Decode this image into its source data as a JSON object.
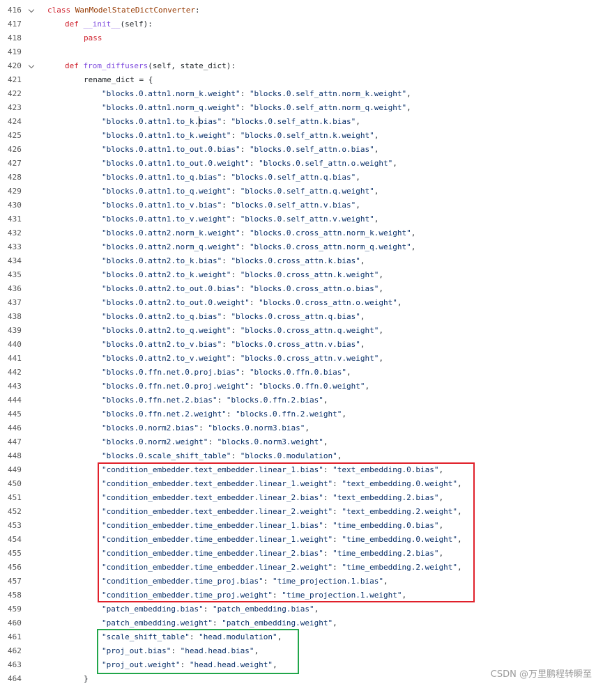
{
  "lines": [
    {
      "n": "416",
      "indent": 0,
      "fold": true,
      "parts": [
        [
          "kw",
          "class "
        ],
        [
          "cls",
          "WanModelStateDictConverter"
        ],
        [
          "plain",
          ":"
        ]
      ]
    },
    {
      "n": "417",
      "indent": 1,
      "fold": false,
      "parts": [
        [
          "kw",
          "def "
        ],
        [
          "fn",
          "__init__"
        ],
        [
          "plain",
          "(self):"
        ]
      ]
    },
    {
      "n": "418",
      "indent": 2,
      "fold": false,
      "parts": [
        [
          "kw",
          "pass"
        ]
      ]
    },
    {
      "n": "419",
      "indent": 0,
      "fold": false,
      "parts": []
    },
    {
      "n": "420",
      "indent": 1,
      "fold": true,
      "parts": [
        [
          "kw",
          "def "
        ],
        [
          "fn",
          "from_diffusers"
        ],
        [
          "plain",
          "(self, state_dict):"
        ]
      ]
    },
    {
      "n": "421",
      "indent": 2,
      "fold": false,
      "parts": [
        [
          "plain",
          "rename_dict = {"
        ]
      ]
    },
    {
      "n": "422",
      "indent": 3,
      "fold": false,
      "parts": [
        [
          "str",
          "\"blocks.0.attn1.norm_k.weight\""
        ],
        [
          "plain",
          ": "
        ],
        [
          "str",
          "\"blocks.0.self_attn.norm_k.weight\""
        ],
        [
          "plain",
          ","
        ]
      ]
    },
    {
      "n": "423",
      "indent": 3,
      "fold": false,
      "parts": [
        [
          "str",
          "\"blocks.0.attn1.norm_q.weight\""
        ],
        [
          "plain",
          ": "
        ],
        [
          "str",
          "\"blocks.0.self_attn.norm_q.weight\""
        ],
        [
          "plain",
          ","
        ]
      ]
    },
    {
      "n": "424",
      "indent": 3,
      "fold": false,
      "parts": [
        [
          "str",
          "\"blocks.0.attn1.to_k.bias\""
        ],
        [
          "plain",
          ": "
        ],
        [
          "str",
          "\"blocks.0.self_attn.k.bias\""
        ],
        [
          "plain",
          ","
        ]
      ]
    },
    {
      "n": "425",
      "indent": 3,
      "fold": false,
      "parts": [
        [
          "str",
          "\"blocks.0.attn1.to_k.weight\""
        ],
        [
          "plain",
          ": "
        ],
        [
          "str",
          "\"blocks.0.self_attn.k.weight\""
        ],
        [
          "plain",
          ","
        ]
      ]
    },
    {
      "n": "426",
      "indent": 3,
      "fold": false,
      "parts": [
        [
          "str",
          "\"blocks.0.attn1.to_out.0.bias\""
        ],
        [
          "plain",
          ": "
        ],
        [
          "str",
          "\"blocks.0.self_attn.o.bias\""
        ],
        [
          "plain",
          ","
        ]
      ]
    },
    {
      "n": "427",
      "indent": 3,
      "fold": false,
      "parts": [
        [
          "str",
          "\"blocks.0.attn1.to_out.0.weight\""
        ],
        [
          "plain",
          ": "
        ],
        [
          "str",
          "\"blocks.0.self_attn.o.weight\""
        ],
        [
          "plain",
          ","
        ]
      ]
    },
    {
      "n": "428",
      "indent": 3,
      "fold": false,
      "parts": [
        [
          "str",
          "\"blocks.0.attn1.to_q.bias\""
        ],
        [
          "plain",
          ": "
        ],
        [
          "str",
          "\"blocks.0.self_attn.q.bias\""
        ],
        [
          "plain",
          ","
        ]
      ]
    },
    {
      "n": "429",
      "indent": 3,
      "fold": false,
      "parts": [
        [
          "str",
          "\"blocks.0.attn1.to_q.weight\""
        ],
        [
          "plain",
          ": "
        ],
        [
          "str",
          "\"blocks.0.self_attn.q.weight\""
        ],
        [
          "plain",
          ","
        ]
      ]
    },
    {
      "n": "430",
      "indent": 3,
      "fold": false,
      "parts": [
        [
          "str",
          "\"blocks.0.attn1.to_v.bias\""
        ],
        [
          "plain",
          ": "
        ],
        [
          "str",
          "\"blocks.0.self_attn.v.bias\""
        ],
        [
          "plain",
          ","
        ]
      ]
    },
    {
      "n": "431",
      "indent": 3,
      "fold": false,
      "parts": [
        [
          "str",
          "\"blocks.0.attn1.to_v.weight\""
        ],
        [
          "plain",
          ": "
        ],
        [
          "str",
          "\"blocks.0.self_attn.v.weight\""
        ],
        [
          "plain",
          ","
        ]
      ]
    },
    {
      "n": "432",
      "indent": 3,
      "fold": false,
      "parts": [
        [
          "str",
          "\"blocks.0.attn2.norm_k.weight\""
        ],
        [
          "plain",
          ": "
        ],
        [
          "str",
          "\"blocks.0.cross_attn.norm_k.weight\""
        ],
        [
          "plain",
          ","
        ]
      ]
    },
    {
      "n": "433",
      "indent": 3,
      "fold": false,
      "parts": [
        [
          "str",
          "\"blocks.0.attn2.norm_q.weight\""
        ],
        [
          "plain",
          ": "
        ],
        [
          "str",
          "\"blocks.0.cross_attn.norm_q.weight\""
        ],
        [
          "plain",
          ","
        ]
      ]
    },
    {
      "n": "434",
      "indent": 3,
      "fold": false,
      "parts": [
        [
          "str",
          "\"blocks.0.attn2.to_k.bias\""
        ],
        [
          "plain",
          ": "
        ],
        [
          "str",
          "\"blocks.0.cross_attn.k.bias\""
        ],
        [
          "plain",
          ","
        ]
      ]
    },
    {
      "n": "435",
      "indent": 3,
      "fold": false,
      "parts": [
        [
          "str",
          "\"blocks.0.attn2.to_k.weight\""
        ],
        [
          "plain",
          ": "
        ],
        [
          "str",
          "\"blocks.0.cross_attn.k.weight\""
        ],
        [
          "plain",
          ","
        ]
      ]
    },
    {
      "n": "436",
      "indent": 3,
      "fold": false,
      "parts": [
        [
          "str",
          "\"blocks.0.attn2.to_out.0.bias\""
        ],
        [
          "plain",
          ": "
        ],
        [
          "str",
          "\"blocks.0.cross_attn.o.bias\""
        ],
        [
          "plain",
          ","
        ]
      ]
    },
    {
      "n": "437",
      "indent": 3,
      "fold": false,
      "parts": [
        [
          "str",
          "\"blocks.0.attn2.to_out.0.weight\""
        ],
        [
          "plain",
          ": "
        ],
        [
          "str",
          "\"blocks.0.cross_attn.o.weight\""
        ],
        [
          "plain",
          ","
        ]
      ]
    },
    {
      "n": "438",
      "indent": 3,
      "fold": false,
      "parts": [
        [
          "str",
          "\"blocks.0.attn2.to_q.bias\""
        ],
        [
          "plain",
          ": "
        ],
        [
          "str",
          "\"blocks.0.cross_attn.q.bias\""
        ],
        [
          "plain",
          ","
        ]
      ]
    },
    {
      "n": "439",
      "indent": 3,
      "fold": false,
      "parts": [
        [
          "str",
          "\"blocks.0.attn2.to_q.weight\""
        ],
        [
          "plain",
          ": "
        ],
        [
          "str",
          "\"blocks.0.cross_attn.q.weight\""
        ],
        [
          "plain",
          ","
        ]
      ]
    },
    {
      "n": "440",
      "indent": 3,
      "fold": false,
      "parts": [
        [
          "str",
          "\"blocks.0.attn2.to_v.bias\""
        ],
        [
          "plain",
          ": "
        ],
        [
          "str",
          "\"blocks.0.cross_attn.v.bias\""
        ],
        [
          "plain",
          ","
        ]
      ]
    },
    {
      "n": "441",
      "indent": 3,
      "fold": false,
      "parts": [
        [
          "str",
          "\"blocks.0.attn2.to_v.weight\""
        ],
        [
          "plain",
          ": "
        ],
        [
          "str",
          "\"blocks.0.cross_attn.v.weight\""
        ],
        [
          "plain",
          ","
        ]
      ]
    },
    {
      "n": "442",
      "indent": 3,
      "fold": false,
      "parts": [
        [
          "str",
          "\"blocks.0.ffn.net.0.proj.bias\""
        ],
        [
          "plain",
          ": "
        ],
        [
          "str",
          "\"blocks.0.ffn.0.bias\""
        ],
        [
          "plain",
          ","
        ]
      ]
    },
    {
      "n": "443",
      "indent": 3,
      "fold": false,
      "parts": [
        [
          "str",
          "\"blocks.0.ffn.net.0.proj.weight\""
        ],
        [
          "plain",
          ": "
        ],
        [
          "str",
          "\"blocks.0.ffn.0.weight\""
        ],
        [
          "plain",
          ","
        ]
      ]
    },
    {
      "n": "444",
      "indent": 3,
      "fold": false,
      "parts": [
        [
          "str",
          "\"blocks.0.ffn.net.2.bias\""
        ],
        [
          "plain",
          ": "
        ],
        [
          "str",
          "\"blocks.0.ffn.2.bias\""
        ],
        [
          "plain",
          ","
        ]
      ]
    },
    {
      "n": "445",
      "indent": 3,
      "fold": false,
      "parts": [
        [
          "str",
          "\"blocks.0.ffn.net.2.weight\""
        ],
        [
          "plain",
          ": "
        ],
        [
          "str",
          "\"blocks.0.ffn.2.weight\""
        ],
        [
          "plain",
          ","
        ]
      ]
    },
    {
      "n": "446",
      "indent": 3,
      "fold": false,
      "parts": [
        [
          "str",
          "\"blocks.0.norm2.bias\""
        ],
        [
          "plain",
          ": "
        ],
        [
          "str",
          "\"blocks.0.norm3.bias\""
        ],
        [
          "plain",
          ","
        ]
      ]
    },
    {
      "n": "447",
      "indent": 3,
      "fold": false,
      "parts": [
        [
          "str",
          "\"blocks.0.norm2.weight\""
        ],
        [
          "plain",
          ": "
        ],
        [
          "str",
          "\"blocks.0.norm3.weight\""
        ],
        [
          "plain",
          ","
        ]
      ]
    },
    {
      "n": "448",
      "indent": 3,
      "fold": false,
      "parts": [
        [
          "str",
          "\"blocks.0.scale_shift_table\""
        ],
        [
          "plain",
          ": "
        ],
        [
          "str",
          "\"blocks.0.modulation\""
        ],
        [
          "plain",
          ","
        ]
      ]
    },
    {
      "n": "449",
      "indent": 3,
      "fold": false,
      "parts": [
        [
          "str",
          "\"condition_embedder.text_embedder.linear_1.bias\""
        ],
        [
          "plain",
          ": "
        ],
        [
          "str",
          "\"text_embedding.0.bias\""
        ],
        [
          "plain",
          ","
        ]
      ]
    },
    {
      "n": "450",
      "indent": 3,
      "fold": false,
      "parts": [
        [
          "str",
          "\"condition_embedder.text_embedder.linear_1.weight\""
        ],
        [
          "plain",
          ": "
        ],
        [
          "str",
          "\"text_embedding.0.weight\""
        ],
        [
          "plain",
          ","
        ]
      ]
    },
    {
      "n": "451",
      "indent": 3,
      "fold": false,
      "parts": [
        [
          "str",
          "\"condition_embedder.text_embedder.linear_2.bias\""
        ],
        [
          "plain",
          ": "
        ],
        [
          "str",
          "\"text_embedding.2.bias\""
        ],
        [
          "plain",
          ","
        ]
      ]
    },
    {
      "n": "452",
      "indent": 3,
      "fold": false,
      "parts": [
        [
          "str",
          "\"condition_embedder.text_embedder.linear_2.weight\""
        ],
        [
          "plain",
          ": "
        ],
        [
          "str",
          "\"text_embedding.2.weight\""
        ],
        [
          "plain",
          ","
        ]
      ]
    },
    {
      "n": "453",
      "indent": 3,
      "fold": false,
      "parts": [
        [
          "str",
          "\"condition_embedder.time_embedder.linear_1.bias\""
        ],
        [
          "plain",
          ": "
        ],
        [
          "str",
          "\"time_embedding.0.bias\""
        ],
        [
          "plain",
          ","
        ]
      ]
    },
    {
      "n": "454",
      "indent": 3,
      "fold": false,
      "parts": [
        [
          "str",
          "\"condition_embedder.time_embedder.linear_1.weight\""
        ],
        [
          "plain",
          ": "
        ],
        [
          "str",
          "\"time_embedding.0.weight\""
        ],
        [
          "plain",
          ","
        ]
      ]
    },
    {
      "n": "455",
      "indent": 3,
      "fold": false,
      "parts": [
        [
          "str",
          "\"condition_embedder.time_embedder.linear_2.bias\""
        ],
        [
          "plain",
          ": "
        ],
        [
          "str",
          "\"time_embedding.2.bias\""
        ],
        [
          "plain",
          ","
        ]
      ]
    },
    {
      "n": "456",
      "indent": 3,
      "fold": false,
      "parts": [
        [
          "str",
          "\"condition_embedder.time_embedder.linear_2.weight\""
        ],
        [
          "plain",
          ": "
        ],
        [
          "str",
          "\"time_embedding.2.weight\""
        ],
        [
          "plain",
          ","
        ]
      ]
    },
    {
      "n": "457",
      "indent": 3,
      "fold": false,
      "parts": [
        [
          "str",
          "\"condition_embedder.time_proj.bias\""
        ],
        [
          "plain",
          ": "
        ],
        [
          "str",
          "\"time_projection.1.bias\""
        ],
        [
          "plain",
          ","
        ]
      ]
    },
    {
      "n": "458",
      "indent": 3,
      "fold": false,
      "parts": [
        [
          "str",
          "\"condition_embedder.time_proj.weight\""
        ],
        [
          "plain",
          ": "
        ],
        [
          "str",
          "\"time_projection.1.weight\""
        ],
        [
          "plain",
          ","
        ]
      ]
    },
    {
      "n": "459",
      "indent": 3,
      "fold": false,
      "parts": [
        [
          "str",
          "\"patch_embedding.bias\""
        ],
        [
          "plain",
          ": "
        ],
        [
          "str",
          "\"patch_embedding.bias\""
        ],
        [
          "plain",
          ","
        ]
      ]
    },
    {
      "n": "460",
      "indent": 3,
      "fold": false,
      "parts": [
        [
          "str",
          "\"patch_embedding.weight\""
        ],
        [
          "plain",
          ": "
        ],
        [
          "str",
          "\"patch_embedding.weight\""
        ],
        [
          "plain",
          ","
        ]
      ]
    },
    {
      "n": "461",
      "indent": 3,
      "fold": false,
      "parts": [
        [
          "str",
          "\"scale_shift_table\""
        ],
        [
          "plain",
          ": "
        ],
        [
          "str",
          "\"head.modulation\""
        ],
        [
          "plain",
          ","
        ]
      ]
    },
    {
      "n": "462",
      "indent": 3,
      "fold": false,
      "parts": [
        [
          "str",
          "\"proj_out.bias\""
        ],
        [
          "plain",
          ": "
        ],
        [
          "str",
          "\"head.head.bias\""
        ],
        [
          "plain",
          ","
        ]
      ]
    },
    {
      "n": "463",
      "indent": 3,
      "fold": false,
      "parts": [
        [
          "str",
          "\"proj_out.weight\""
        ],
        [
          "plain",
          ": "
        ],
        [
          "str",
          "\"head.head.weight\""
        ],
        [
          "plain",
          ","
        ]
      ]
    },
    {
      "n": "464",
      "indent": 2,
      "fold": false,
      "parts": [
        [
          "plain",
          "}"
        ]
      ]
    }
  ],
  "highlights": {
    "red_box_color": "#e0202a",
    "green_box_color": "#21a64a"
  },
  "watermark": "CSDN @万里鹏程转瞬至"
}
